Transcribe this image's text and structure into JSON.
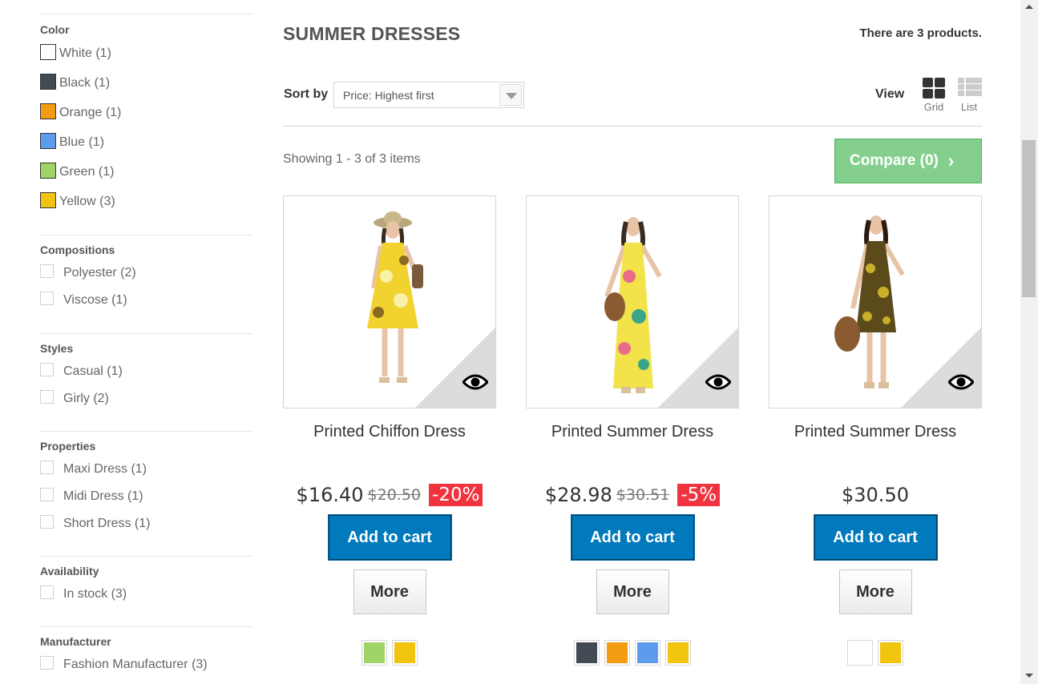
{
  "filters": {
    "color": {
      "title": "Color",
      "items": [
        {
          "label": "White (1)",
          "color": "#ffffff"
        },
        {
          "label": "Black (1)",
          "color": "#434a54"
        },
        {
          "label": "Orange (1)",
          "color": "#f39c11"
        },
        {
          "label": "Blue (1)",
          "color": "#5d9cec"
        },
        {
          "label": "Green (1)",
          "color": "#a0d468"
        },
        {
          "label": "Yellow (3)",
          "color": "#f1c40f"
        }
      ]
    },
    "compositions": {
      "title": "Compositions",
      "items": [
        "Polyester (2)",
        "Viscose (1)"
      ]
    },
    "styles": {
      "title": "Styles",
      "items": [
        "Casual (1)",
        "Girly (2)"
      ]
    },
    "properties": {
      "title": "Properties",
      "items": [
        "Maxi Dress (1)",
        "Midi Dress (1)",
        "Short Dress (1)"
      ]
    },
    "availability": {
      "title": "Availability",
      "items": [
        "In stock (3)"
      ]
    },
    "manufacturer": {
      "title": "Manufacturer",
      "items": [
        "Fashion Manufacturer (3)"
      ]
    }
  },
  "category": {
    "title": "SUMMER DRESSES",
    "count": "There are 3 products."
  },
  "sort": {
    "label": "Sort by",
    "value": "Price: Highest first"
  },
  "view": {
    "label": "View",
    "grid": "Grid",
    "list": "List"
  },
  "showing": "Showing 1 - 3 of 3 items",
  "compare": {
    "label": "Compare (0)",
    "chevron": "›"
  },
  "products": [
    {
      "name": "Printed Chiffon Dress",
      "price": "$16.40",
      "old_price": "$20.50",
      "discount": "-20%",
      "add_label": "Add to cart",
      "more_label": "More",
      "colors": [
        "#a0d468",
        "#f1c40f"
      ],
      "dress_color": "#f2d22e",
      "pattern_color": "#f9f1a5"
    },
    {
      "name": "Printed Summer Dress",
      "price": "$28.98",
      "old_price": "$30.51",
      "discount": "-5%",
      "add_label": "Add to cart",
      "more_label": "More",
      "colors": [
        "#434a54",
        "#f39c11",
        "#5d9cec",
        "#f1c40f"
      ],
      "dress_color": "#f2e34a",
      "pattern_color": "#e86c8a"
    },
    {
      "name": "Printed Summer Dress",
      "price": "$30.50",
      "old_price": "",
      "discount": "",
      "add_label": "Add to cart",
      "more_label": "More",
      "colors": [
        "#ffffff",
        "#f1c40f"
      ],
      "dress_color": "#5b4a1a",
      "pattern_color": "#c8b02a"
    }
  ]
}
